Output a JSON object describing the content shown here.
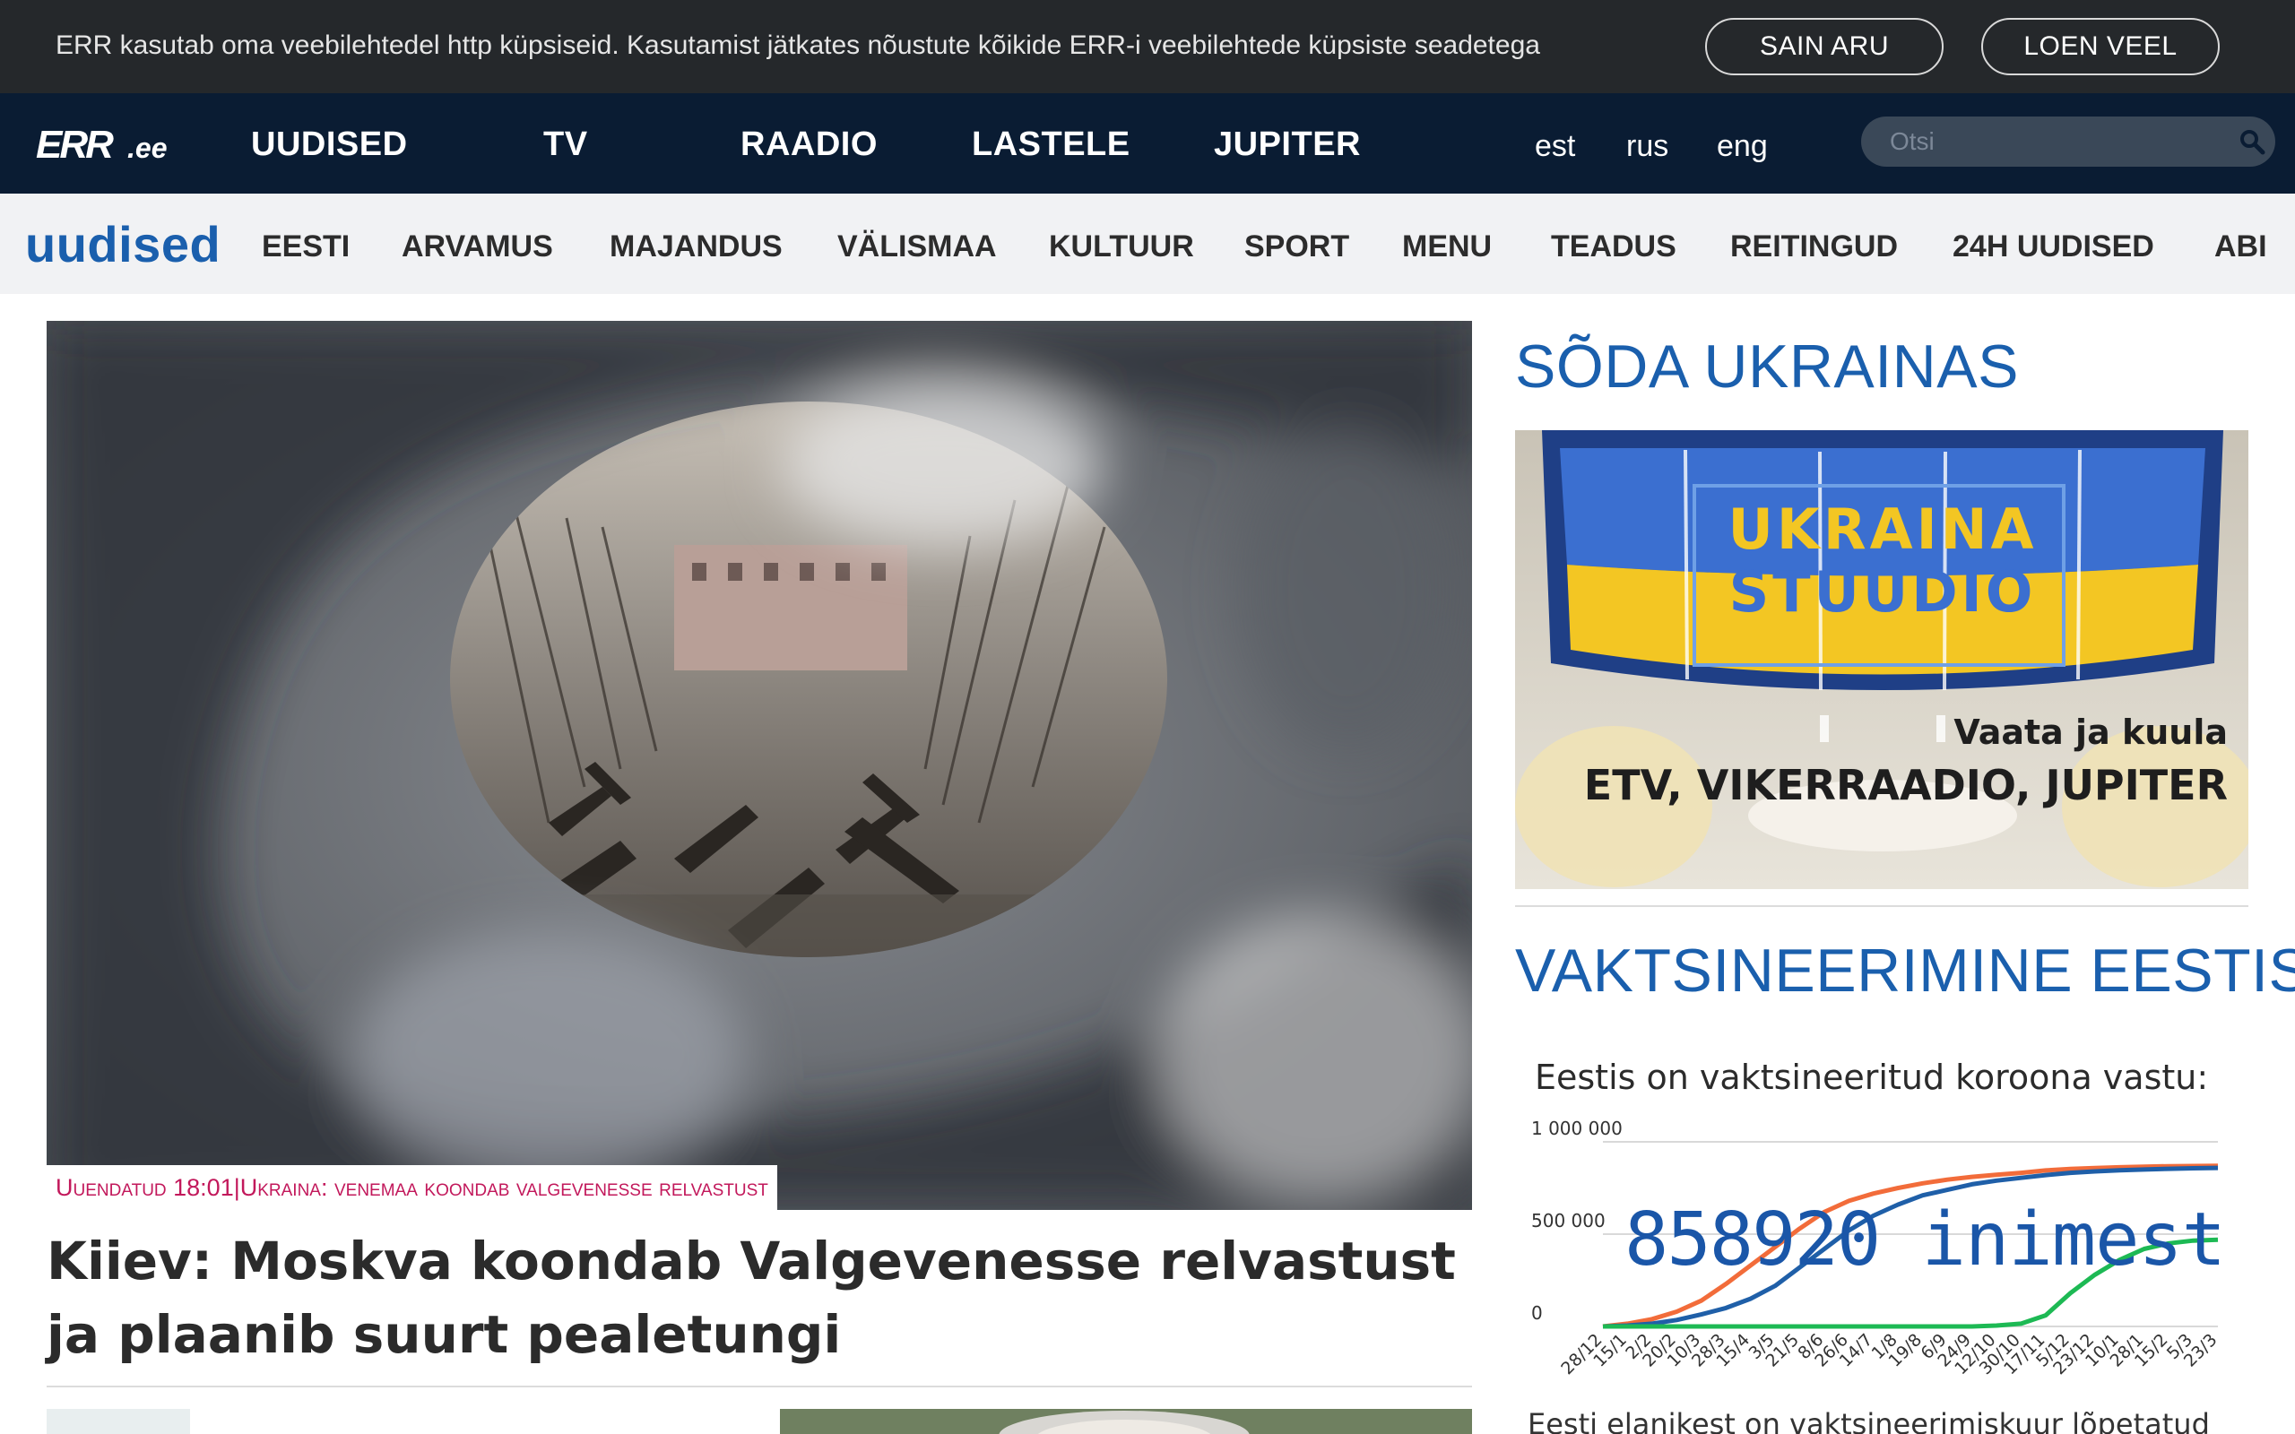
{
  "cookie_bar": {
    "text": "ERR kasutab oma veebilehtedel http küpsiseid. Kasutamist jätkates nõustute kõikide ERR-i veebilehtede küpsiste seadetega",
    "accept_label": "SAIN ARU",
    "more_label": "LOEN VEEL"
  },
  "header": {
    "logo_text": "ERR",
    "logo_suffix": ".ee",
    "nav": [
      "UUDISED",
      "TV",
      "RAADIO",
      "LASTELE",
      "JUPITER"
    ],
    "languages": [
      "est",
      "rus",
      "eng"
    ],
    "search_placeholder": "Otsi",
    "search_icon": "search-icon"
  },
  "section_nav": {
    "brand": "uudised",
    "items": [
      "EESTI",
      "ARVAMUS",
      "MAJANDUS",
      "VÄLISMAA",
      "KULTUUR",
      "SPORT",
      "MENU",
      "TEADUS",
      "REITINGUD",
      "24H UUDISED",
      "ABI"
    ]
  },
  "lead_article": {
    "tag_updated": "Uuendatud 18:01",
    "tag_separator": " | ",
    "tag_topic": "Ukraina: venemaa koondab valgevenesse relvastust",
    "title": "Kiiev: Moskva koondab Valgevenesse relvastust ja plaanib suurt pealetungi"
  },
  "sidebar": {
    "war_title": "SÕDA UKRAINAS",
    "promo": {
      "logo_line1": "UKRAINA",
      "logo_line2": "STUUDIO",
      "subtitle": "Vaata ja kuula",
      "channels": "ETV, VIKERRAADIO, JUPITER"
    },
    "vaccination_title": "VAKTSINEERIMINE EESTIS",
    "vaccination": {
      "caption": "Eestis on vaktsineeritud koroona vastu:",
      "count": "858920",
      "count_unit": "inimest",
      "footer": "Eesti elanikest on vaktsineerimiskuur lõpetatud"
    }
  },
  "chart_data": {
    "type": "line",
    "title": "",
    "xlabel": "",
    "ylabel": "",
    "ylim": [
      0,
      1000000
    ],
    "y_ticks": [
      "0",
      "500 000",
      "1 000 000"
    ],
    "x": [
      "28/12",
      "15/1",
      "2/2",
      "20/2",
      "10/3",
      "28/3",
      "15/4",
      "3/5",
      "21/5",
      "8/6",
      "26/6",
      "14/7",
      "1/8",
      "19/8",
      "6/9",
      "24/9",
      "12/10",
      "30/10",
      "17/11",
      "5/12",
      "23/12",
      "10/1",
      "28/1",
      "15/2",
      "5/3",
      "23/3"
    ],
    "series": [
      {
        "color": "#f26c3a",
        "values": [
          0,
          15000,
          40000,
          80000,
          140000,
          230000,
          330000,
          430000,
          530000,
          620000,
          680000,
          720000,
          750000,
          775000,
          795000,
          810000,
          822000,
          832000,
          845000,
          853000,
          858000,
          862000,
          865000,
          868000,
          869000,
          870000
        ]
      },
      {
        "color": "#1f5fa8",
        "values": [
          0,
          5000,
          15000,
          35000,
          65000,
          100000,
          150000,
          220000,
          320000,
          420000,
          520000,
          600000,
          660000,
          710000,
          740000,
          770000,
          790000,
          805000,
          820000,
          832000,
          840000,
          846000,
          850000,
          854000,
          857000,
          858920
        ]
      },
      {
        "color": "#1db954",
        "values": [
          0,
          0,
          0,
          0,
          0,
          0,
          0,
          0,
          0,
          0,
          0,
          0,
          0,
          0,
          0,
          0,
          5000,
          15000,
          60000,
          180000,
          280000,
          360000,
          420000,
          450000,
          465000,
          470000
        ]
      }
    ]
  }
}
